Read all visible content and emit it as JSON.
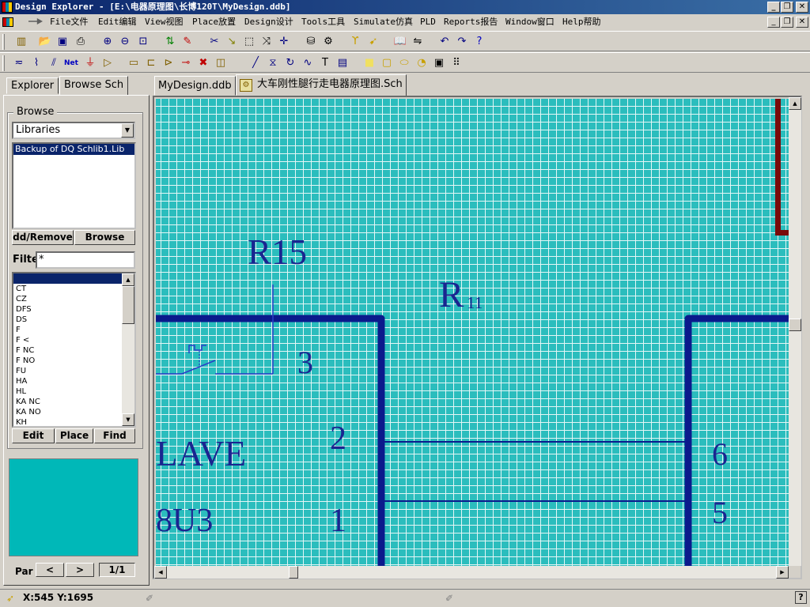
{
  "window": {
    "title": "Design Explorer - [E:\\电器原理图\\长博120T\\MyDesign.ddb]",
    "minimize_glyph": "_",
    "restore_glyph": "❐",
    "close_glyph": "✕"
  },
  "menu": [
    {
      "label": "File文件"
    },
    {
      "label": "Edit编辑"
    },
    {
      "label": "View视图"
    },
    {
      "label": "Place放置"
    },
    {
      "label": "Design设计"
    },
    {
      "label": "Tools工具"
    },
    {
      "label": "Simulate仿真"
    },
    {
      "label": "PLD"
    },
    {
      "label": "Reports报告"
    },
    {
      "label": "Window窗口"
    },
    {
      "label": "Help帮助"
    }
  ],
  "toolbar_main": [
    {
      "icon": "design-manager-icon",
      "glyph": "▥",
      "color": "#806000"
    },
    {
      "icon": "open-icon",
      "glyph": "📂",
      "color": "#c8a000"
    },
    {
      "icon": "save-icon",
      "glyph": "▣",
      "color": "#000080"
    },
    {
      "icon": "print-icon",
      "glyph": "⎙",
      "color": "#000"
    },
    {
      "icon": "zoom-in-icon",
      "glyph": "⊕",
      "color": "#000080"
    },
    {
      "icon": "zoom-out-icon",
      "glyph": "⊖",
      "color": "#000080"
    },
    {
      "icon": "zoom-area-icon",
      "glyph": "⊡",
      "color": "#000080"
    },
    {
      "icon": "hierarchy-icon",
      "glyph": "⇅",
      "color": "#008000"
    },
    {
      "icon": "pencil-icon",
      "glyph": "✎",
      "color": "#c00000"
    },
    {
      "icon": "cut-icon",
      "glyph": "✂",
      "color": "#000080"
    },
    {
      "icon": "paste-icon",
      "glyph": "↘",
      "color": "#808000"
    },
    {
      "icon": "select-icon",
      "glyph": "⬚",
      "color": "#000"
    },
    {
      "icon": "deselect-icon",
      "glyph": "⤨",
      "color": "#000"
    },
    {
      "icon": "move-icon",
      "glyph": "✛",
      "color": "#000080"
    },
    {
      "icon": "library-icon",
      "glyph": "⛁",
      "color": "#000"
    },
    {
      "icon": "browse-lib-icon",
      "glyph": "⚙",
      "color": "#000"
    },
    {
      "icon": "probe-icon",
      "glyph": "ϒ",
      "color": "#c8a000"
    },
    {
      "icon": "cross-probe-icon",
      "glyph": "➹",
      "color": "#c8a000"
    },
    {
      "icon": "book-icon",
      "glyph": "📖",
      "color": "#000"
    },
    {
      "icon": "tools-icon",
      "glyph": "⇋",
      "color": "#000"
    },
    {
      "icon": "undo-icon",
      "glyph": "↶",
      "color": "#000080"
    },
    {
      "icon": "redo-icon",
      "glyph": "↷",
      "color": "#000080"
    },
    {
      "icon": "help-icon",
      "glyph": "?",
      "color": "#0000c0"
    }
  ],
  "toolbar_wiring": [
    {
      "icon": "wire-icon",
      "glyph": "≂",
      "color": "#000080"
    },
    {
      "icon": "bus-icon",
      "glyph": "⌇",
      "color": "#000080"
    },
    {
      "icon": "bus-entry-icon",
      "glyph": "⫽",
      "color": "#000080"
    },
    {
      "icon": "net-label-icon",
      "glyph": "Net",
      "color": "#0000c0"
    },
    {
      "icon": "power-port-icon",
      "glyph": "⏚",
      "color": "#c00000"
    },
    {
      "icon": "part-icon",
      "glyph": "▷",
      "color": "#806000"
    },
    {
      "icon": "sheet-symbol-icon",
      "glyph": "▭",
      "color": "#806000"
    },
    {
      "icon": "sheet-entry-icon",
      "glyph": "⊏",
      "color": "#806000"
    },
    {
      "icon": "port-icon",
      "glyph": "⊳",
      "color": "#806000"
    },
    {
      "icon": "junction-icon",
      "glyph": "⊸",
      "color": "#c00000"
    },
    {
      "icon": "no-erc-icon",
      "glyph": "✖",
      "color": "#c00000"
    },
    {
      "icon": "pcb-layout-icon",
      "glyph": "◫",
      "color": "#806000"
    },
    {
      "icon": "line-icon",
      "glyph": "╱",
      "color": "#000080"
    },
    {
      "icon": "polygon-icon",
      "glyph": "⧖",
      "color": "#000080"
    },
    {
      "icon": "arc-icon",
      "glyph": "↻",
      "color": "#000080"
    },
    {
      "icon": "bezier-icon",
      "glyph": "∿",
      "color": "#000080"
    },
    {
      "icon": "text-icon",
      "glyph": "T",
      "color": "#000"
    },
    {
      "icon": "text-frame-icon",
      "glyph": "▤",
      "color": "#000080"
    },
    {
      "icon": "rectangle-icon",
      "glyph": "■",
      "color": "#f0e060"
    },
    {
      "icon": "round-rect-icon",
      "glyph": "▢",
      "color": "#c8a000"
    },
    {
      "icon": "ellipse-icon",
      "glyph": "⬭",
      "color": "#c8a000"
    },
    {
      "icon": "pie-icon",
      "glyph": "◔",
      "color": "#c8a000"
    },
    {
      "icon": "graphic-icon",
      "glyph": "▣",
      "color": "#000"
    },
    {
      "icon": "array-icon",
      "glyph": "⠿",
      "color": "#000"
    }
  ],
  "panel": {
    "tabs": [
      "Explorer",
      "Browse Sch"
    ],
    "browse_label": "Browse",
    "browse_value": "Libraries",
    "libraries": [
      "Backup of DQ Schlib1.Lib"
    ],
    "add_remove": "dd/Remove",
    "browse_button": "Browse",
    "filter_label": "Filte",
    "filter_value": "*",
    "components": [
      "",
      "CT",
      "CZ",
      "DFS",
      "DS",
      "F",
      "F <",
      "F NC",
      "F NO",
      "FU",
      "HA",
      "HL",
      "KA NC",
      "KA NO",
      "KH"
    ],
    "edit_button": "Edit",
    "place_button": "Place",
    "find_button": "Find",
    "preview_color": "#00b8b8",
    "part_label": "Par",
    "prev_glyph": "<",
    "next_glyph": ">",
    "part_counter": "1/1"
  },
  "doc_tabs": [
    "MyDesign.ddb",
    "大车刚性腿行走电器原理图.Sch"
  ],
  "schematic": {
    "sheet_color": "#2bbdbd",
    "grid_color": "#e4f6f6",
    "wire_color": "#0b1a8c",
    "thin_wire_color": "#2a3cc8",
    "border_color": "#7a0a0a",
    "labels": [
      "R15",
      "R",
      "11",
      "3",
      "2",
      "6",
      "5",
      "LAVE",
      "8U3",
      "1"
    ]
  },
  "status": {
    "coords": "X:545 Y:1695",
    "help_glyph": "?"
  }
}
